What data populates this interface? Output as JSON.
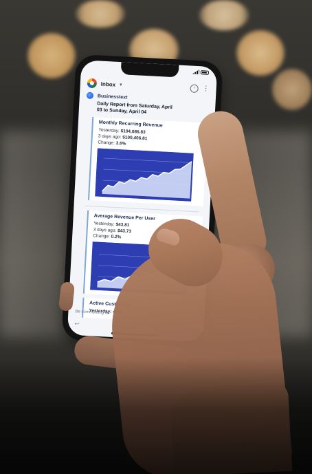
{
  "scene": {
    "accent_color": "#2d3fb5"
  },
  "phone": {
    "status_time": "",
    "mailbox_label": "Inbox",
    "mailbox_chevron": "▾",
    "menu_icon": "account-icon",
    "overflow_icon": "more-icon"
  },
  "email": {
    "sender_name": "Businesstext",
    "sender_meta": "",
    "report_line_1": "Daily Report from Saturday, April",
    "report_line_2": "03 to Sunday, April 04",
    "cards": [
      {
        "title": "Monthly Recurring Revenue",
        "line1_label": "Yesterday:",
        "line1_value": "$104,086.83",
        "line2_label": "3 days ago:",
        "line2_value": "$100,406.81",
        "line3_label": "Change:",
        "line3_value": "3.6%"
      },
      {
        "title": "Average Revenue Per User",
        "line1_label": "Yesterday:",
        "line1_value": "$43.81",
        "line2_label": "3 days ago:",
        "line2_value": "$43.73",
        "line3_label": "Change:",
        "line3_value": "0.2%"
      }
    ],
    "third_card_title": "Active Customers",
    "third_card_line": "Yesterday: 4986"
  },
  "footer": {
    "reply_text": "Be commenting on",
    "action_icons": [
      "reply-icon",
      "forward-icon",
      "archive-icon",
      "mail-icon"
    ]
  }
}
